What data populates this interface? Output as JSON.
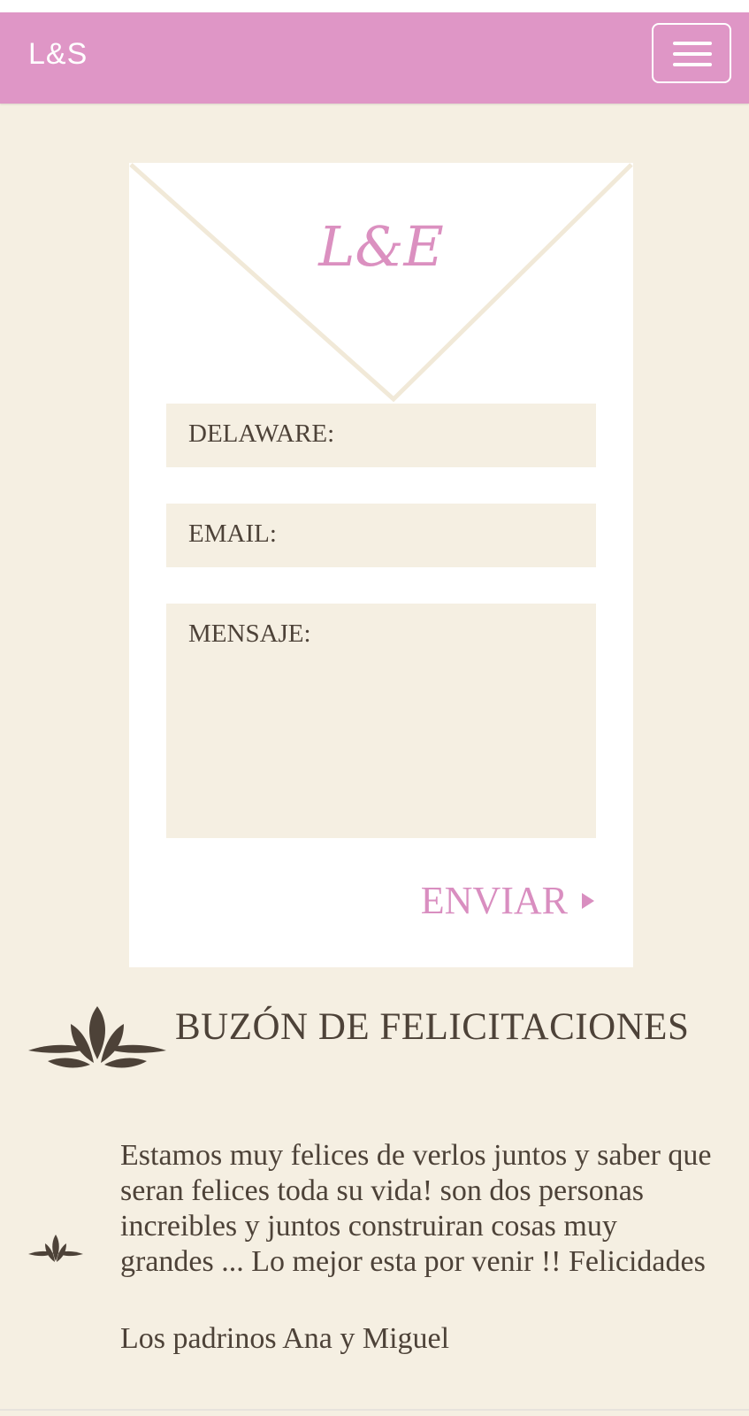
{
  "navbar": {
    "brand": "L&S",
    "menu_icon": "hamburger-menu-icon",
    "color": "#df96c6"
  },
  "card": {
    "monogram": "L&E",
    "fields": {
      "name_label": "DELAWARE:",
      "email_label": "EMAIL:",
      "message_label": "MENSAJE:"
    },
    "submit_label": "ENVIAR",
    "submit_icon": "play-triangle-icon"
  },
  "guestbook": {
    "title": "BUZÓN DE FELICITACIONES",
    "title_icon": "leaf-ornament-icon",
    "entries": [
      {
        "icon": "small-leaf-ornament-icon",
        "message": "Estamos muy felices de verlos juntos y saber que seran felices toda su vida! son dos personas increibles y juntos construiran cosas muy grandes ... Lo mejor esta por venir !! Felicidades",
        "author": "Los padrinos Ana y Miguel"
      }
    ]
  },
  "colors": {
    "background": "#f5efe2",
    "accent": "#df96c6",
    "text": "#4d4238"
  }
}
